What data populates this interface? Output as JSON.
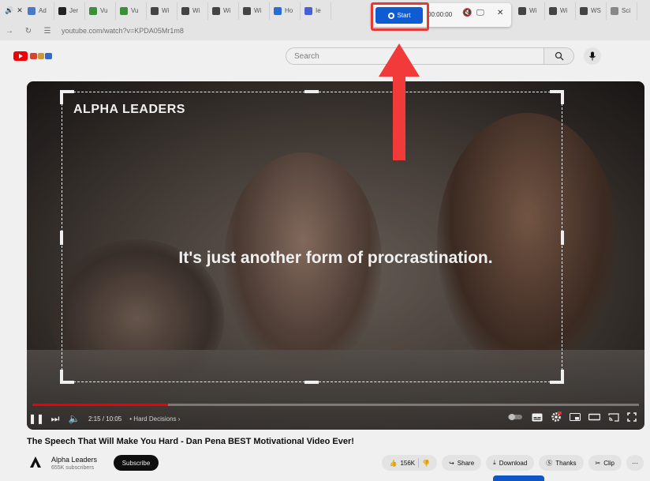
{
  "browser": {
    "tabs": [
      {
        "label": "Ad",
        "icon": "google-icon",
        "color": "#4a78c8"
      },
      {
        "label": "Jer",
        "icon": "x-icon",
        "color": "#222222"
      },
      {
        "label": "Vu",
        "icon": "v-icon",
        "color": "#3b8f3b"
      },
      {
        "label": "Vu",
        "icon": "v-icon",
        "color": "#3b8f3b"
      },
      {
        "label": "Wi",
        "icon": "wikipedia-icon",
        "color": "#444444"
      },
      {
        "label": "Wi",
        "icon": "wikipedia-icon",
        "color": "#444444"
      },
      {
        "label": "Wi",
        "icon": "wikipedia-icon",
        "color": "#444444"
      },
      {
        "label": "Wi",
        "icon": "wikipedia-icon",
        "color": "#444444"
      },
      {
        "label": "Ho",
        "icon": "globe-icon",
        "color": "#2b6cd4"
      },
      {
        "label": "Ie",
        "icon": "chat-icon",
        "color": "#4660d8"
      }
    ],
    "tabs_right": [
      {
        "label": "Wi",
        "icon": "wikipedia-icon",
        "color": "#444444"
      },
      {
        "label": "Wi",
        "icon": "wikipedia-icon",
        "color": "#444444"
      },
      {
        "label": "WS",
        "icon": "wikipedia-icon",
        "color": "#444444"
      },
      {
        "label": "Sci",
        "icon": "sci-icon",
        "color": "#888888"
      }
    ],
    "url": "youtube.com/watch?v=KPDA05Mr1m8"
  },
  "youtube": {
    "search_placeholder": "Search"
  },
  "video": {
    "brand": "ALPHA LEADERS",
    "subtitle": "It's just another form of procrastination.",
    "time": "2:15 / 10:05",
    "chapter": "• Hard Decisions ›",
    "progress": 0.224
  },
  "recorder": {
    "start_label": "Start",
    "timer": "00:00:00"
  },
  "meta": {
    "title": "The Speech That Will Make You Hard - Dan Pena BEST Motivational Video Ever!",
    "channel": "Alpha Leaders",
    "subscribers": "655K subscribers",
    "subscribe_label": "Subscribe",
    "likes": "156K",
    "share_label": "Share",
    "download_label": "Download",
    "thanks_label": "Thanks",
    "clip_label": "Clip",
    "more_label": "⋯"
  },
  "colors": {
    "accent_blue": "#0f5bd3",
    "highlight_red": "#e53935",
    "youtube_red": "#ff0000"
  }
}
